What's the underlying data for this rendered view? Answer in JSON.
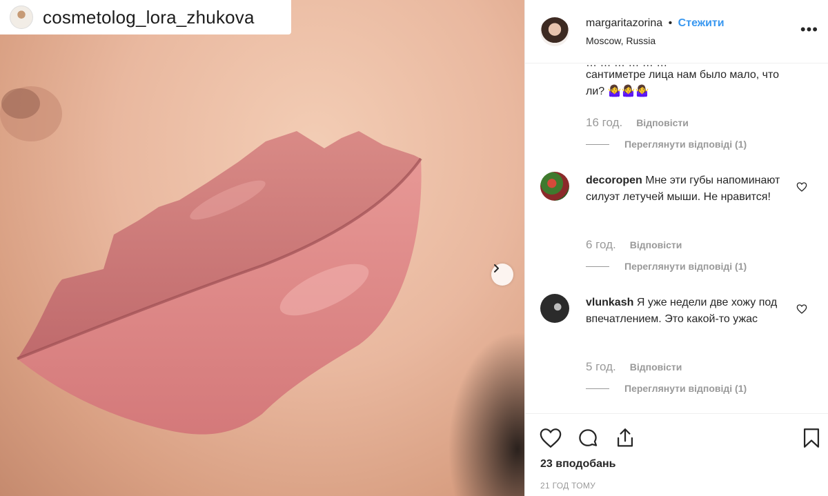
{
  "photo": {
    "watermark": "cosmetolog_lora_zhukova",
    "next_icon": "chevron-right-icon"
  },
  "header": {
    "username": "margaritazorina",
    "dot": "•",
    "follow": "Стежити",
    "location": "Moscow, Russia",
    "more": "•••"
  },
  "comments": {
    "top_clip": "… … … … … …",
    "top_text": "сантиметре лица нам было мало, что ли? 🤷‍♀️🤷‍♀️🤷‍♀️",
    "top_time": "16 год.",
    "items": [
      {
        "username": "decoropen",
        "text": "Мне эти губы напоминают силуэт летучей мыши. Не нравится!",
        "time": "6 год."
      },
      {
        "username": "vlunkash",
        "text": "Я уже недели две хожу под впечатлением. Это какой-то ужас",
        "time": "5 год."
      }
    ],
    "reply_label": "Відповісти",
    "view_replies": "Переглянути відповіді (1)"
  },
  "actions": {
    "likes": "23 вподобань",
    "timestamp": "21 ГОД ТОМУ"
  },
  "colors": {
    "link": "#3897f0",
    "muted": "#999999",
    "text": "#262626"
  }
}
